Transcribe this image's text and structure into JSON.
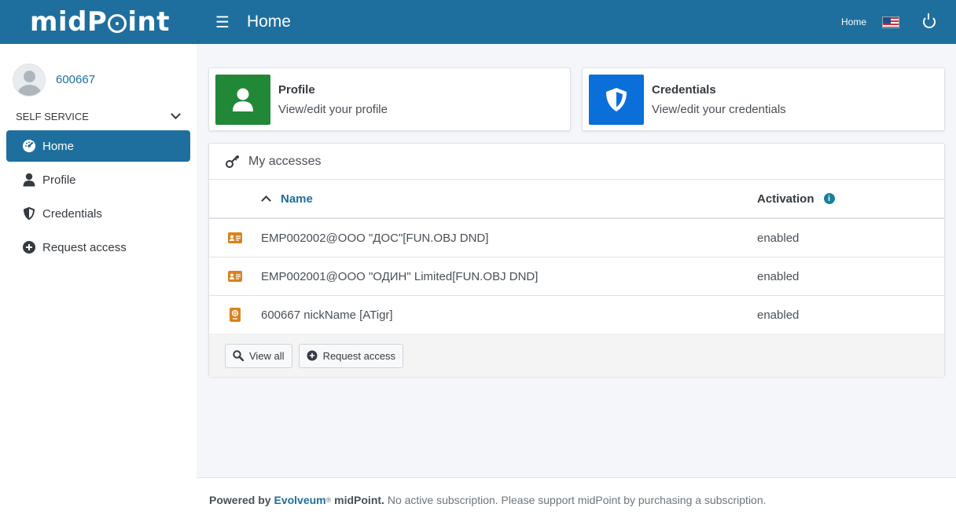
{
  "header": {
    "brand": {
      "prefix": "midP",
      "suffix": "int"
    },
    "title": "Home",
    "home_link": "Home"
  },
  "sidebar": {
    "username": "600667",
    "section": "SELF SERVICE",
    "items": [
      {
        "label": "Home",
        "icon": "dashboard-icon"
      },
      {
        "label": "Profile",
        "icon": "user-icon"
      },
      {
        "label": "Credentials",
        "icon": "shield-icon"
      },
      {
        "label": "Request access",
        "icon": "plus-circle-icon"
      }
    ]
  },
  "tiles": {
    "profile": {
      "title": "Profile",
      "desc": "View/edit your profile",
      "color": "#218838"
    },
    "credentials": {
      "title": "Credentials",
      "desc": "View/edit your credentials",
      "color": "#0a6fd9"
    }
  },
  "accesses": {
    "title": "My accesses",
    "columns": {
      "name": "Name",
      "activation": "Activation"
    },
    "rows": [
      {
        "name": "EMP002002@OOO \"ДОС\"[FUN.OBJ DND]",
        "status": "enabled",
        "icon": "id-card-icon"
      },
      {
        "name": "EMP002001@OOO \"ОДИН\" Limited[FUN.OBJ DND]",
        "status": "enabled",
        "icon": "id-card-icon"
      },
      {
        "name": "600667 nickName [ATigr]",
        "status": "enabled",
        "icon": "passport-icon"
      }
    ],
    "buttons": {
      "view_all": "View all",
      "request_access": "Request access"
    }
  },
  "footer": {
    "powered": "Powered by",
    "company": "Evolveum",
    "reg": "®",
    "product": "midPoint.",
    "notice": "No active subscription. Please support midPoint by purchasing a subscription."
  }
}
